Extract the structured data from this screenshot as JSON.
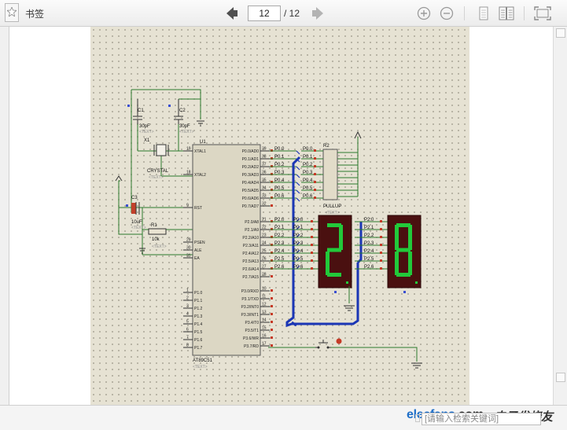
{
  "toolbar": {
    "bookmark_label": "书签",
    "page_current": "12",
    "page_total": "/ 12",
    "icons": [
      "bookmark-icon",
      "prev-page-icon",
      "next-page-icon",
      "zoom-in-icon",
      "zoom-out-icon",
      "single-page-icon",
      "two-page-icon",
      "fullscreen-icon"
    ]
  },
  "schematic": {
    "caps": {
      "c1_name": "C1",
      "c1_value": "30pF",
      "c2_name": "C2",
      "c2_value": "30pF",
      "c3_name": "C3",
      "c3_value": "10uF",
      "text_placeholder": "<TEXT>"
    },
    "crystal": {
      "name": "X1",
      "value": "CRYSTAL"
    },
    "resistor": {
      "name": "R1",
      "value": "10k"
    },
    "rpack": {
      "name": "R2",
      "value": "PULLUP"
    },
    "mcu": {
      "ref": "U1",
      "part": "AT89C51",
      "left_pins": [
        {
          "num": "19",
          "name": "XTAL1"
        },
        {
          "num": "18",
          "name": "XTAL2"
        },
        {
          "num": "9",
          "name": "RST"
        },
        {
          "num": "29",
          "name": "PSEN"
        },
        {
          "num": "30",
          "name": "ALE"
        },
        {
          "num": "31",
          "name": "EA"
        },
        {
          "num": "1",
          "name": "P1.0"
        },
        {
          "num": "2",
          "name": "P1.1"
        },
        {
          "num": "3",
          "name": "P1.2"
        },
        {
          "num": "4",
          "name": "P1.3"
        },
        {
          "num": "5",
          "name": "P1.4"
        },
        {
          "num": "6",
          "name": "P1.5"
        },
        {
          "num": "7",
          "name": "P1.6"
        },
        {
          "num": "8",
          "name": "P1.7"
        }
      ],
      "right_pins_p0": [
        {
          "num": "39",
          "name": "P0.0/AD0"
        },
        {
          "num": "38",
          "name": "P0.1/AD1"
        },
        {
          "num": "37",
          "name": "P0.2/AD2"
        },
        {
          "num": "36",
          "name": "P0.3/AD3"
        },
        {
          "num": "35",
          "name": "P0.4/AD4"
        },
        {
          "num": "34",
          "name": "P0.5/AD5"
        },
        {
          "num": "33",
          "name": "P0.6/AD6"
        },
        {
          "num": "32",
          "name": "P0.7/AD7"
        }
      ],
      "right_pins_p2": [
        {
          "num": "21",
          "name": "P2.0/A8"
        },
        {
          "num": "22",
          "name": "P2.1/A9"
        },
        {
          "num": "23",
          "name": "P2.2/A10"
        },
        {
          "num": "24",
          "name": "P2.3/A11"
        },
        {
          "num": "25",
          "name": "P2.4/A12"
        },
        {
          "num": "26",
          "name": "P2.5/A13"
        },
        {
          "num": "27",
          "name": "P2.6/A14"
        },
        {
          "num": "28",
          "name": "P2.7/A15"
        }
      ],
      "right_pins_p3": [
        {
          "num": "10",
          "name": "P3.0/RXD"
        },
        {
          "num": "11",
          "name": "P3.1/TXD"
        },
        {
          "num": "12",
          "name": "P3.2/INT0"
        },
        {
          "num": "13",
          "name": "P3.3/INT1"
        },
        {
          "num": "14",
          "name": "P3.4/T0"
        },
        {
          "num": "15",
          "name": "P3.5/T1"
        },
        {
          "num": "16",
          "name": "P3.6/WR"
        },
        {
          "num": "17",
          "name": "P3.7/RD"
        }
      ]
    },
    "p0_net_labels": [
      "P0.0",
      "P0.1",
      "P0.2",
      "P0.3",
      "P0.4",
      "P0.5",
      "P0.6"
    ],
    "p2_net_labels": [
      "P2.0",
      "P2.1",
      "P2.2",
      "P2.3",
      "P2.4",
      "P2.5",
      "P2.6"
    ],
    "display_left_p0": [
      "P0.0",
      "P0.1",
      "P0.2",
      "P0.3",
      "P0.4",
      "P0.5",
      "P0.6"
    ],
    "display_right_p2": [
      "P2.0",
      "P2.1",
      "P2.2",
      "P2.3",
      "P2.4",
      "P2.5",
      "P2.6"
    ],
    "digit_left": "2",
    "digit_right": "8",
    "segment_color": "#22c93a",
    "display_bg": "#4a1010",
    "bus_color": "#1b36b5"
  },
  "footer": {
    "brand": "elecfans",
    "brand_suffix": ".com",
    "brand_cn": "电子发烧友",
    "search_placeholder": "[请输入检索关键词]"
  }
}
